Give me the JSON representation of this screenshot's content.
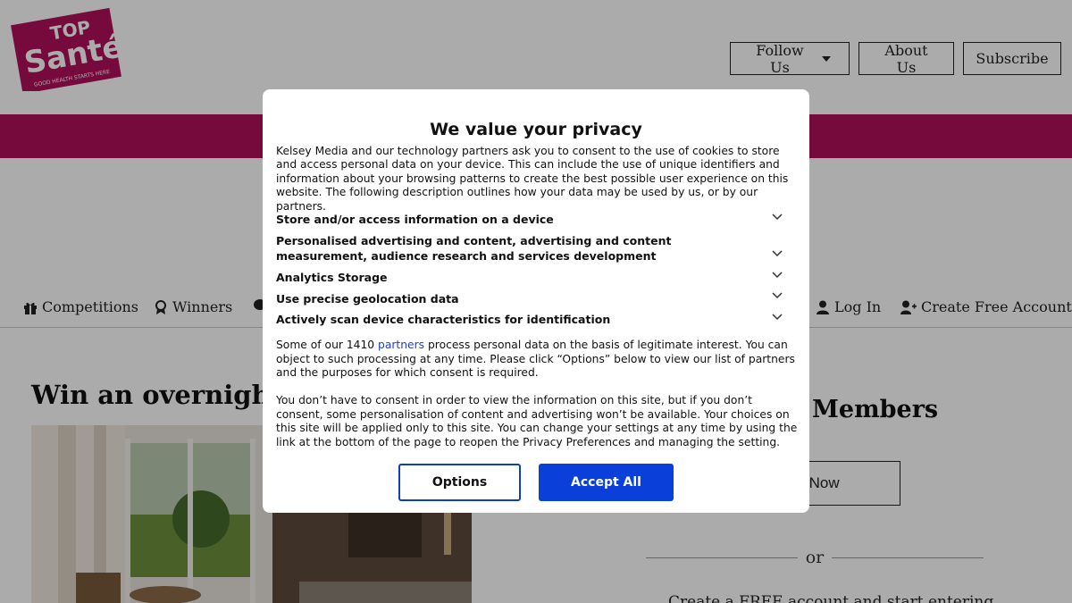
{
  "brand": {
    "logo_top": "TOP",
    "logo_main": "Santé",
    "tagline": "GOOD HEALTH STARTS HERE",
    "primary_color": "#b0105a"
  },
  "header": {
    "follow_label": "Follow Us",
    "about_label": "About Us",
    "subscribe_label": "Subscribe"
  },
  "nav": {
    "competitions": "Competitions",
    "winners": "Winners",
    "log_in": "Log In",
    "create_account": "Create Free Account"
  },
  "article": {
    "title": "Win an overnight s"
  },
  "sidebar": {
    "members_title": "Members",
    "join_label": "n Now",
    "or_label": "or",
    "bottom_text": "Create a FREE account and start entering"
  },
  "consent": {
    "title": "We value your privacy",
    "intro": "Kelsey Media and our technology partners ask you to consent to the use of cookies to store and access personal data on your device. This can include the use of unique identifiers and information about your browsing patterns to create the best possible user experience on this website. The following description outlines how your data may be used by us, or by our partners.",
    "purposes": [
      "Store and/or access information on a device",
      "Personalised advertising and content, advertising and content measurement, audience research and services development",
      "Analytics Storage",
      "Use precise geolocation data",
      "Actively scan device characteristics for identification"
    ],
    "partners_before": "Some of our 1410 ",
    "partners_link": "partners",
    "partners_after": " process personal data on the basis of legitimate interest. You can object to such processing at any time. Please click “Options” below to view our list of partners and the purposes for which consent is required.",
    "no_consent_text": "You don’t have to consent in order to view the information on this site, but if you don’t consent, some personalisation of content and advertising won’t be available. Your choices on this site will be applied only to this site. You can change your settings at any time by using the link at the bottom of the page to reopen the Privacy Preferences and managing the setting.",
    "options_label": "Options",
    "accept_label": "Accept All",
    "accent_color": "#0b3fd9"
  }
}
